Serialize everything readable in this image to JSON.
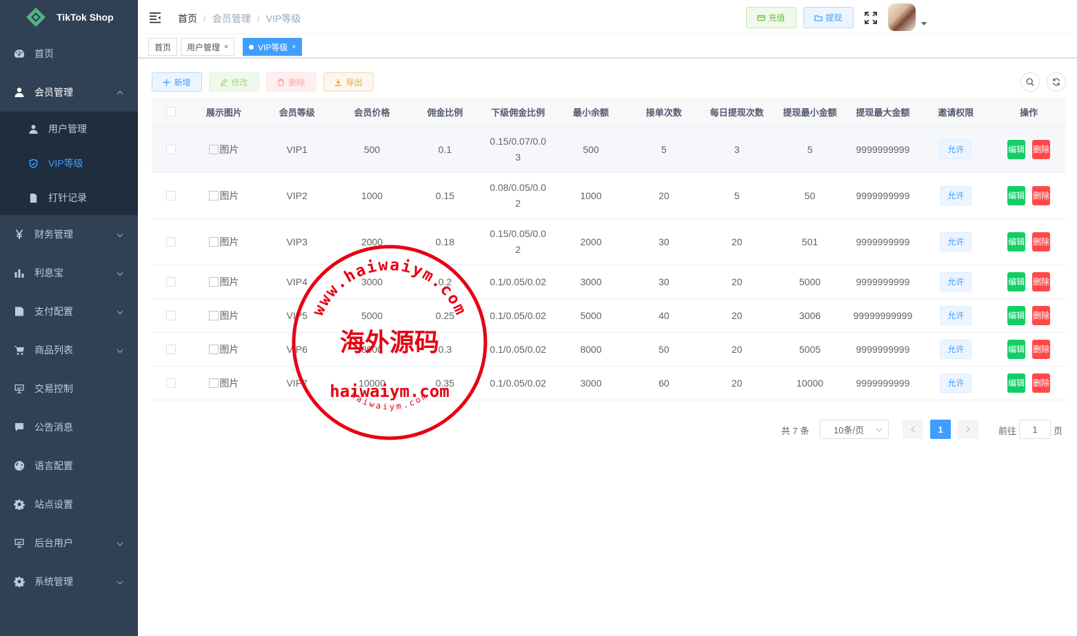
{
  "app": {
    "brand": "TikTok Shop"
  },
  "sidebar": {
    "items": [
      {
        "label": "首页",
        "icon": "dashboard-icon"
      },
      {
        "label": "会员管理",
        "icon": "user-icon",
        "open": true,
        "children": [
          {
            "label": "用户管理",
            "icon": "user-icon"
          },
          {
            "label": "VIP等级",
            "icon": "shield-icon",
            "active": true
          },
          {
            "label": "打针记录",
            "icon": "document-icon"
          }
        ]
      },
      {
        "label": "财务管理",
        "icon": "yen-icon"
      },
      {
        "label": "利息宝",
        "icon": "bar-chart-icon"
      },
      {
        "label": "支付配置",
        "icon": "list-icon"
      },
      {
        "label": "商品列表",
        "icon": "cart-icon"
      },
      {
        "label": "交易控制",
        "icon": "monitor-icon"
      },
      {
        "label": "公告消息",
        "icon": "message-icon"
      },
      {
        "label": "语言配置",
        "icon": "globe-icon"
      },
      {
        "label": "站点设置",
        "icon": "gear-icon"
      },
      {
        "label": "后台用户",
        "icon": "monitor-icon"
      },
      {
        "label": "系统管理",
        "icon": "gear-icon"
      }
    ]
  },
  "header": {
    "breadcrumb": [
      "首页",
      "会员管理",
      "VIP等级"
    ],
    "recharge_label": "充值",
    "withdraw_label": "提现"
  },
  "tags": [
    {
      "label": "首页"
    },
    {
      "label": "用户管理",
      "close": "×"
    },
    {
      "label": "VIP等级",
      "close": "×",
      "active": true
    }
  ],
  "toolbar": {
    "add_label": "新增",
    "edit_label": "修改",
    "delete_label": "删除",
    "export_label": "导出"
  },
  "table": {
    "columns": [
      "展示图片",
      "会员等级",
      "会员价格",
      "佣金比例",
      "下级佣金比例",
      "最小余额",
      "接单次数",
      "每日提现次数",
      "提现最小金额",
      "提现最大金额",
      "邀请权限",
      "操作"
    ],
    "image_alt": "图片",
    "permission_label": "允许",
    "edit_label": "编辑",
    "delete_label": "删除",
    "rows": [
      {
        "level": "VIP1",
        "price": "500",
        "commission": "0.1",
        "sub_commission": [
          "0.15/0.07/0.0",
          "3"
        ],
        "min_balance": "500",
        "orders": "5",
        "daily_withdraw": "3",
        "withdraw_min": "5",
        "withdraw_max": "9999999999"
      },
      {
        "level": "VIP2",
        "price": "1000",
        "commission": "0.15",
        "sub_commission": [
          "0.08/0.05/0.0",
          "2"
        ],
        "min_balance": "1000",
        "orders": "20",
        "daily_withdraw": "5",
        "withdraw_min": "50",
        "withdraw_max": "9999999999"
      },
      {
        "level": "VIP3",
        "price": "2000",
        "commission": "0.18",
        "sub_commission": [
          "0.15/0.05/0.0",
          "2"
        ],
        "min_balance": "2000",
        "orders": "30",
        "daily_withdraw": "20",
        "withdraw_min": "501",
        "withdraw_max": "9999999999"
      },
      {
        "level": "VIP4",
        "price": "3000",
        "commission": "0.2",
        "sub_commission": [
          "0.1/0.05/0.02"
        ],
        "min_balance": "3000",
        "orders": "30",
        "daily_withdraw": "20",
        "withdraw_min": "5000",
        "withdraw_max": "9999999999"
      },
      {
        "level": "VIP5",
        "price": "5000",
        "commission": "0.25",
        "sub_commission": [
          "0.1/0.05/0.02"
        ],
        "min_balance": "5000",
        "orders": "40",
        "daily_withdraw": "20",
        "withdraw_min": "3006",
        "withdraw_max": "99999999999"
      },
      {
        "level": "VIP6",
        "price": "8000",
        "commission": "0.3",
        "sub_commission": [
          "0.1/0.05/0.02"
        ],
        "min_balance": "8000",
        "orders": "50",
        "daily_withdraw": "20",
        "withdraw_min": "5005",
        "withdraw_max": "9999999999"
      },
      {
        "level": "VIP7",
        "price": "10000",
        "commission": "0.35",
        "sub_commission": [
          "0.1/0.05/0.02"
        ],
        "min_balance": "3000",
        "orders": "60",
        "daily_withdraw": "20",
        "withdraw_min": "10000",
        "withdraw_max": "9999999999"
      }
    ]
  },
  "pagination": {
    "total_text": "共 7 条",
    "page_size": "10条/页",
    "current_page": "1",
    "goto_label": "前往",
    "goto_value": "1",
    "page_suffix": "页"
  },
  "watermark": {
    "top_arc": "www.haiwaiym.com",
    "center": "海外源码",
    "middle": "haiwaiym.com",
    "bottom_arc": "haiwaiym.com"
  },
  "colors": {
    "sidebar_bg": "#304156",
    "submenu_bg": "#1f2d3d",
    "primary": "#409eff",
    "success": "#13ce66",
    "danger": "#ff4949",
    "stamp": "#e60012"
  }
}
